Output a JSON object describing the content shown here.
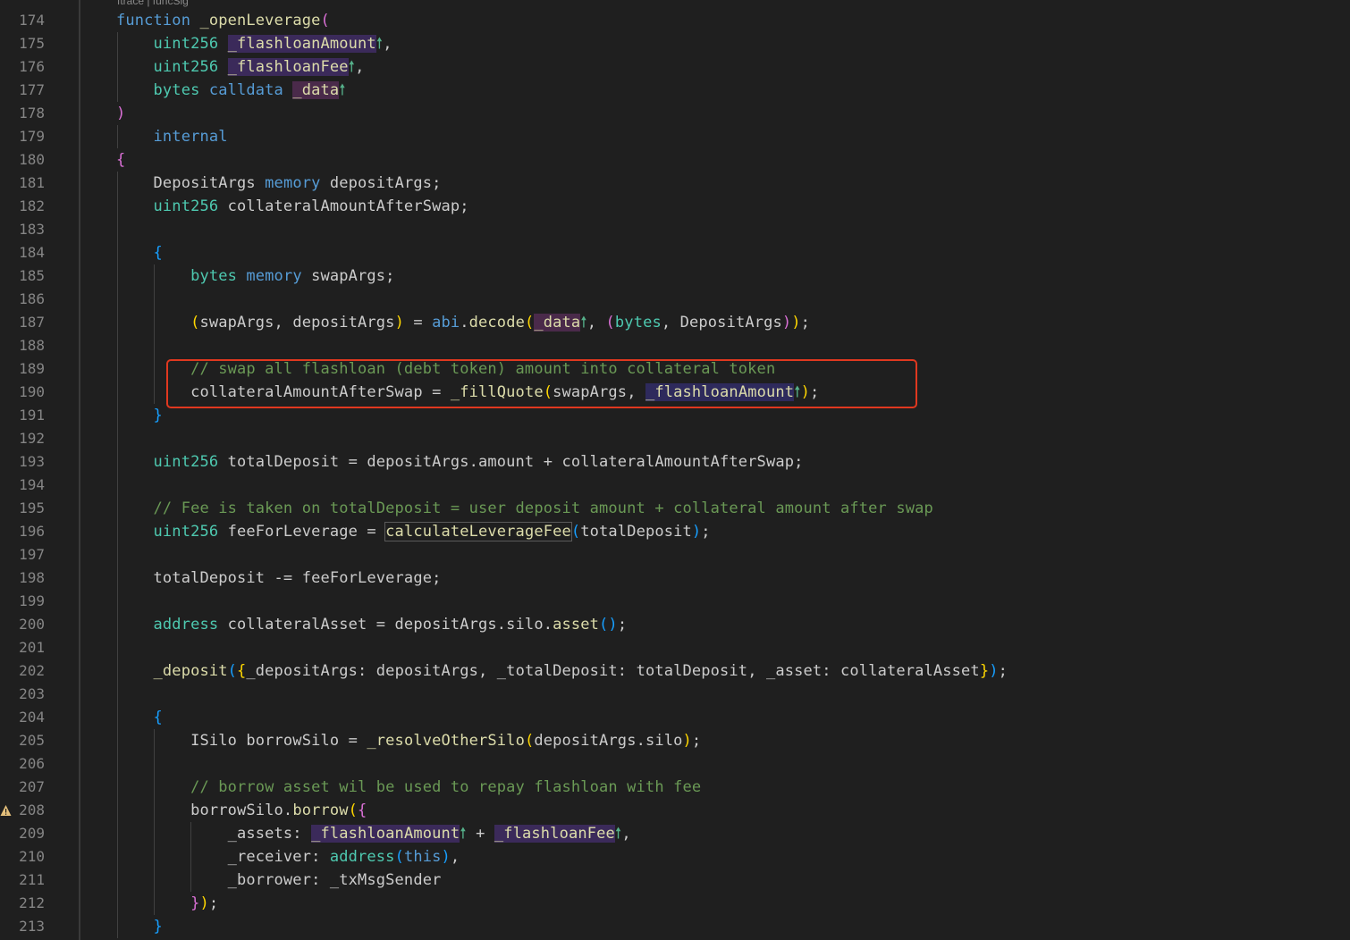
{
  "editor": {
    "codelens": "ftrace | funcSig",
    "highlight_color": "#e0381f",
    "line_numbers": [
      "174",
      "175",
      "176",
      "177",
      "178",
      "179",
      "180",
      "181",
      "182",
      "183",
      "184",
      "185",
      "186",
      "187",
      "188",
      "189",
      "190",
      "191",
      "192",
      "193",
      "194",
      "195",
      "196",
      "197",
      "198",
      "199",
      "200",
      "201",
      "202",
      "203",
      "204",
      "205",
      "206",
      "207",
      "208",
      "209",
      "210",
      "211",
      "212",
      "213"
    ],
    "warning_line": "208",
    "warning_icon": "warning-triangle-icon",
    "lines": [
      [
        [
          "kw",
          "function"
        ],
        [
          "id",
          " "
        ],
        [
          "fn",
          "_openLeverage"
        ],
        [
          "b1",
          "("
        ]
      ],
      [
        [
          "ty",
          "    uint256"
        ],
        [
          "id",
          " "
        ],
        [
          "pm",
          "_flashloanAmount"
        ],
        [
          "up",
          "🠕"
        ],
        [
          "id",
          ","
        ]
      ],
      [
        [
          "ty",
          "    uint256"
        ],
        [
          "id",
          " "
        ],
        [
          "pm",
          "_flashloanFee"
        ],
        [
          "up",
          "🠕"
        ],
        [
          "id",
          ","
        ]
      ],
      [
        [
          "ty",
          "    bytes"
        ],
        [
          "id",
          " "
        ],
        [
          "kw",
          "calldata"
        ],
        [
          "id",
          " "
        ],
        [
          "pd",
          "_data"
        ],
        [
          "up",
          "🠕"
        ]
      ],
      [
        [
          "b1",
          ")"
        ]
      ],
      [
        [
          "kw",
          "    internal"
        ]
      ],
      [
        [
          "b1",
          "{"
        ]
      ],
      [
        [
          "id",
          "    DepositArgs "
        ],
        [
          "kw",
          "memory"
        ],
        [
          "id",
          " depositArgs;"
        ]
      ],
      [
        [
          "ty",
          "    uint256"
        ],
        [
          "id",
          " collateralAmountAfterSwap;"
        ]
      ],
      [],
      [
        [
          "b2",
          "    {"
        ]
      ],
      [
        [
          "ty",
          "        bytes"
        ],
        [
          "id",
          " "
        ],
        [
          "kw",
          "memory"
        ],
        [
          "id",
          " swapArgs;"
        ]
      ],
      [],
      [
        [
          "b3",
          "        ("
        ],
        [
          "id",
          "swapArgs, depositArgs"
        ],
        [
          "b3",
          ")"
        ],
        [
          "id",
          " = "
        ],
        [
          "kw",
          "abi"
        ],
        [
          "id",
          "."
        ],
        [
          "fn",
          "decode"
        ],
        [
          "b3",
          "("
        ],
        [
          "pd",
          "_data"
        ],
        [
          "up",
          "🠕"
        ],
        [
          "id",
          ", "
        ],
        [
          "b1",
          "("
        ],
        [
          "ty",
          "bytes"
        ],
        [
          "id",
          ", "
        ],
        [
          "id",
          "DepositArgs"
        ],
        [
          "b1",
          ")"
        ],
        [
          "b3",
          ")"
        ],
        [
          "id",
          ";"
        ]
      ],
      [],
      [
        [
          "cm",
          "        // swap all flashloan (debt token) amount into collateral token"
        ]
      ],
      [
        [
          "id",
          "        collateralAmountAfterSwap = "
        ],
        [
          "fn",
          "_fillQuote"
        ],
        [
          "b3",
          "("
        ],
        [
          "id",
          "swapArgs, "
        ],
        [
          "pu",
          "_flashloanAmount"
        ],
        [
          "up",
          "🠕"
        ],
        [
          "b3",
          ")"
        ],
        [
          "id",
          ";"
        ]
      ],
      [
        [
          "b2",
          "    }"
        ]
      ],
      [],
      [
        [
          "ty",
          "    uint256"
        ],
        [
          "id",
          " totalDeposit = depositArgs.amount + collateralAmountAfterSwap;"
        ]
      ],
      [],
      [
        [
          "cm",
          "    // Fee is taken on totalDeposit = user deposit amount + collateral amount after swap"
        ]
      ],
      [
        [
          "ty",
          "    uint256"
        ],
        [
          "id",
          " feeForLeverage = "
        ],
        [
          "fnbox",
          "calculateLeverageFee"
        ],
        [
          "b2",
          "("
        ],
        [
          "id",
          "totalDeposit"
        ],
        [
          "b2",
          ")"
        ],
        [
          "id",
          ";"
        ]
      ],
      [],
      [
        [
          "id",
          "    totalDeposit -= feeForLeverage;"
        ]
      ],
      [],
      [
        [
          "ty",
          "    address"
        ],
        [
          "id",
          " collateralAsset = depositArgs.silo."
        ],
        [
          "fn",
          "asset"
        ],
        [
          "b2",
          "()"
        ],
        [
          "id",
          ";"
        ]
      ],
      [],
      [
        [
          "fn",
          "    _deposit"
        ],
        [
          "b2",
          "("
        ],
        [
          "b3",
          "{"
        ],
        [
          "id",
          "_depositArgs: depositArgs, _totalDeposit: totalDeposit, _asset: collateralAsset"
        ],
        [
          "b3",
          "}"
        ],
        [
          "b2",
          ")"
        ],
        [
          "id",
          ";"
        ]
      ],
      [],
      [
        [
          "b2",
          "    {"
        ]
      ],
      [
        [
          "id",
          "        ISilo borrowSilo = "
        ],
        [
          "fn",
          "_resolveOtherSilo"
        ],
        [
          "b3",
          "("
        ],
        [
          "id",
          "depositArgs.silo"
        ],
        [
          "b3",
          ")"
        ],
        [
          "id",
          ";"
        ]
      ],
      [],
      [
        [
          "cm",
          "        // borrow asset wil be used to repay flashloan with fee"
        ]
      ],
      [
        [
          "id",
          "        borrowSilo."
        ],
        [
          "fn",
          "borrow"
        ],
        [
          "b3",
          "("
        ],
        [
          "b1",
          "{"
        ]
      ],
      [
        [
          "id",
          "            _assets: "
        ],
        [
          "pm",
          "_flashloanAmount"
        ],
        [
          "up",
          "🠕"
        ],
        [
          "id",
          " + "
        ],
        [
          "pm",
          "_flashloanFee"
        ],
        [
          "up",
          "🠕"
        ],
        [
          "id",
          ","
        ]
      ],
      [
        [
          "id",
          "            _receiver: "
        ],
        [
          "ty",
          "address"
        ],
        [
          "b2",
          "("
        ],
        [
          "kw",
          "this"
        ],
        [
          "b2",
          ")"
        ],
        [
          "id",
          ","
        ]
      ],
      [
        [
          "id",
          "            _borrower: _txMsgSender"
        ]
      ],
      [
        [
          "b1",
          "        }"
        ],
        [
          "b3",
          ")"
        ],
        [
          "id",
          ";"
        ]
      ],
      [
        [
          "b2",
          "    }"
        ]
      ]
    ]
  }
}
